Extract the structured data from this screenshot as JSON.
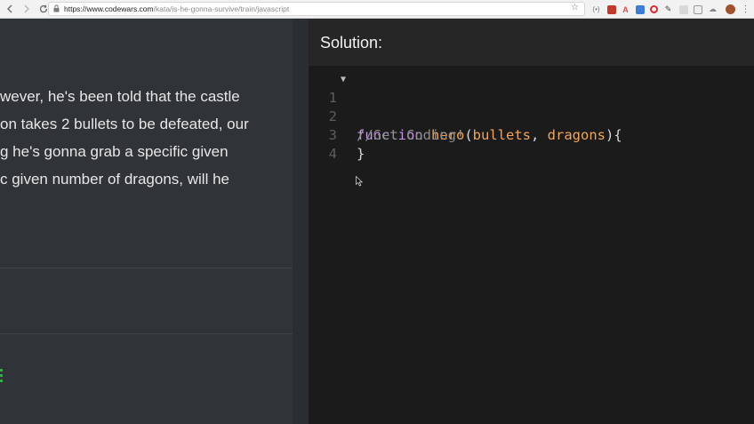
{
  "browser": {
    "url_host": "https://www.codewars.com",
    "url_path": "/kata/is-he-gonna-survive/train/javascript",
    "nav_icons": [
      "back-icon",
      "forward-icon",
      "reload-icon"
    ],
    "extension_icons": [
      "extension-wave-icon",
      "extension-red-icon",
      "extension-translate-icon",
      "extension-blue-icon",
      "extension-opera-icon",
      "extension-pen-icon",
      "extension-gray-icon",
      "extension-square-icon",
      "extension-cloud-icon",
      "profile-avatar-icon",
      "menu-dots-icon"
    ]
  },
  "description": {
    "lines": [
      "wever, he's been told that the castle",
      "on takes 2 bullets to be defeated, our",
      "g he's gonna grab a specific given",
      "c given number of dragons, will he"
    ]
  },
  "solution": {
    "title": "Solution:",
    "line_numbers": [
      "1",
      "2",
      "3",
      "4"
    ],
    "code": {
      "keyword": "function",
      "name": "hero",
      "open_paren": "(",
      "param1": "bullets",
      "comma": ", ",
      "param2": "dragons",
      "close_brace_open": "){",
      "comment": "//Get Coding!",
      "close_brace": "}"
    }
  },
  "colors": {
    "accent_green": "#3cb44a",
    "keyword": "#c792ea",
    "function_name": "#f5a24b"
  }
}
